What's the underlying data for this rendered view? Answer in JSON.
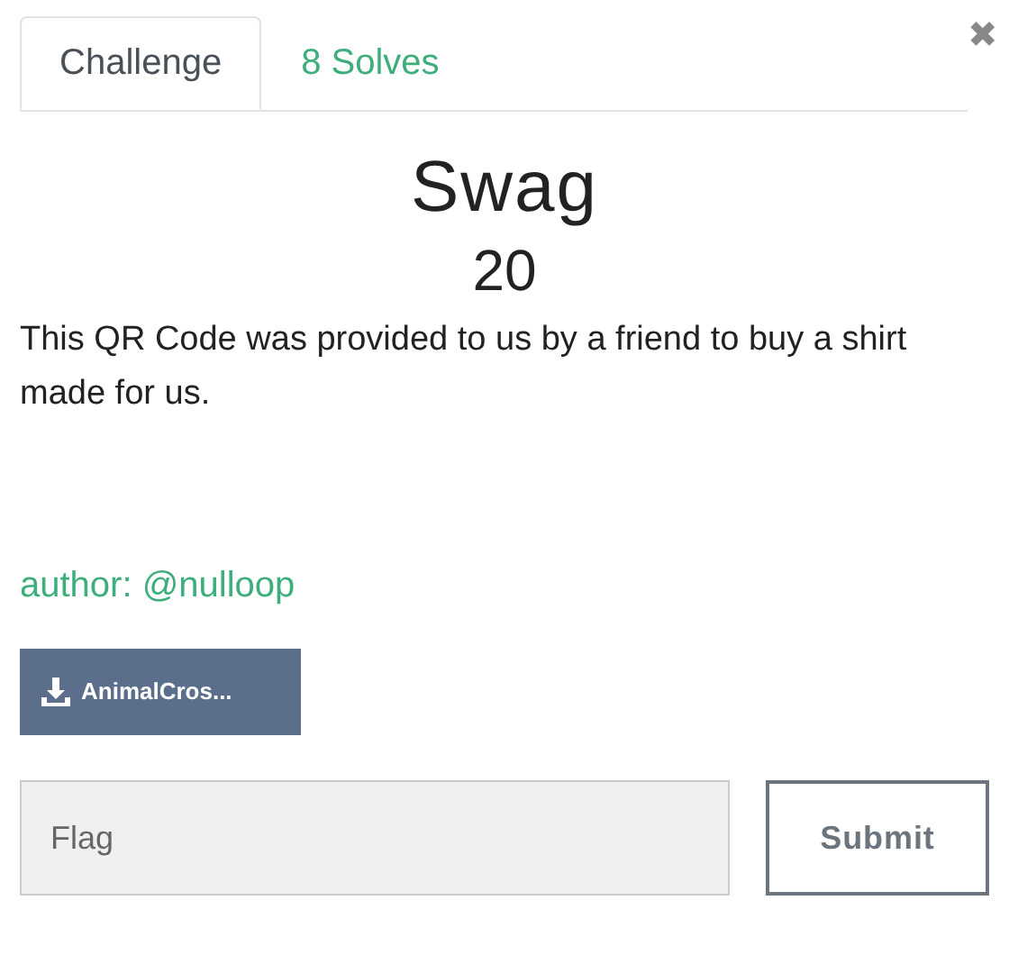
{
  "close": "✖",
  "tabs": [
    {
      "label": "Challenge",
      "selected": true
    },
    {
      "label": "8 Solves",
      "selected": false
    }
  ],
  "title": "Swag",
  "points": "20",
  "description": "This QR Code was provided to us by a friend to buy a shirt made for us.",
  "author": "author: @nulloop",
  "file": {
    "label": "AnimalCros..."
  },
  "flag": {
    "placeholder": "Flag"
  },
  "submit": "Submit"
}
